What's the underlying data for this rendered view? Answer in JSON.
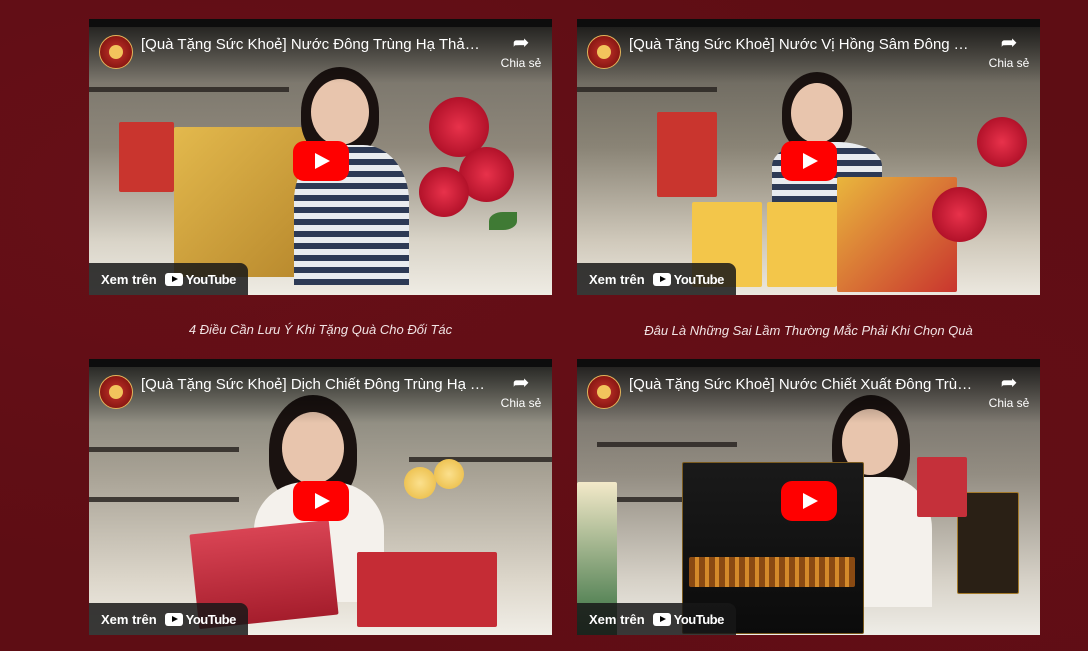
{
  "videos": [
    {
      "title": "[Quà Tặng Sức Khoẻ] Nước Đông Trùng Hạ Thảo S...",
      "share_label": "Chia sẻ",
      "watch_label": "Xem trên",
      "platform": "YouTube"
    },
    {
      "title": "[Quà Tặng Sức Khoẻ] Nước Vị Hồng Sâm Đông Trù...",
      "share_label": "Chia sẻ",
      "watch_label": "Xem trên",
      "platform": "YouTube"
    },
    {
      "title": "[Quà Tặng Sức Khoẻ] Dịch Chiết Đông Trùng Hạ T...",
      "share_label": "Chia sẻ",
      "watch_label": "Xem trên",
      "platform": "YouTube"
    },
    {
      "title": "[Quà Tặng Sức Khoẻ] Nước Chiết Xuất Đông Trùng...",
      "share_label": "Chia sẻ",
      "watch_label": "Xem trên",
      "platform": "YouTube"
    }
  ],
  "captions": [
    "4 Điều Cần Lưu Ý Khi Tặng Quà Cho Đối Tác",
    "Đâu Là Những Sai Lầm Thường Mắc Phải Khi Chọn Quà"
  ],
  "icons": {
    "share": "share-arrow-icon",
    "play": "play-icon",
    "youtube": "youtube-logo"
  },
  "colors": {
    "background": "#5e0d14",
    "play_button": "#ff0000",
    "caption_text": "#f1e3e4"
  }
}
